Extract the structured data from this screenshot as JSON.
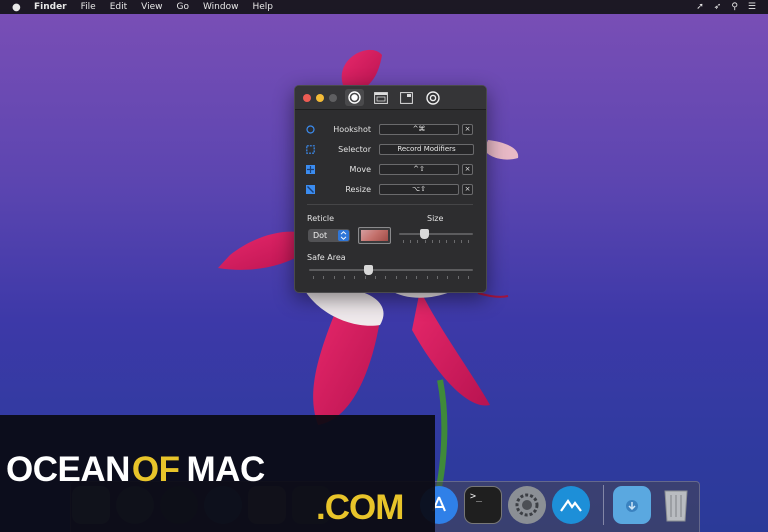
{
  "menubar": {
    "items": [
      "Finder",
      "File",
      "Edit",
      "View",
      "Go",
      "Window",
      "Help"
    ]
  },
  "prefs": {
    "shortcuts": [
      {
        "label": "Hookshot",
        "key": "^⌘",
        "clearable": true
      },
      {
        "label": "Selector",
        "key": "Record Modifiers",
        "clearable": false
      },
      {
        "label": "Move",
        "key": "^⇧",
        "clearable": true
      },
      {
        "label": "Resize",
        "key": "⌥⇧",
        "clearable": true
      }
    ],
    "clear_label": "×",
    "reticle_label": "Reticle",
    "reticle_value": "Dot",
    "size_label": "Size",
    "safe_area_label": "Safe Area",
    "size_level": 0.35,
    "safe_area_level": 0.36
  },
  "watermark": {
    "ocean": "OCEAN",
    "of": "OF",
    "mac": "MAC",
    "com": ".COM"
  },
  "colors": {
    "accent": "#2f76d8",
    "watermark_white": "#ffffff",
    "watermark_yellow": "#e8c42a"
  }
}
